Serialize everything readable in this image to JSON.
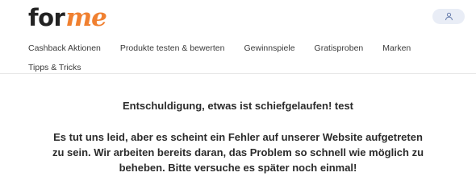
{
  "header": {
    "logo_left": "for",
    "logo_right": "me",
    "user_icon": "user-icon"
  },
  "nav": {
    "items": [
      {
        "label": "Cashback Aktionen"
      },
      {
        "label": "Produkte testen & bewerten"
      },
      {
        "label": "Gewinnspiele"
      },
      {
        "label": "Gratisproben"
      },
      {
        "label": "Marken"
      },
      {
        "label": "Tipps & Tricks"
      }
    ]
  },
  "main": {
    "title": "Entschuldigung, etwas ist schiefgelaufen! test",
    "message": "Es tut uns leid, aber es scheint ein Fehler auf unserer Website aufgetreten zu sein. Wir arbeiten bereits daran, das Problem so schnell wie möglich zu beheben. Bitte versuche es später noch einmal!"
  },
  "colors": {
    "brand_orange": "#f08030",
    "user_button_bg": "#e9edf6",
    "text": "#2b2b2b"
  }
}
